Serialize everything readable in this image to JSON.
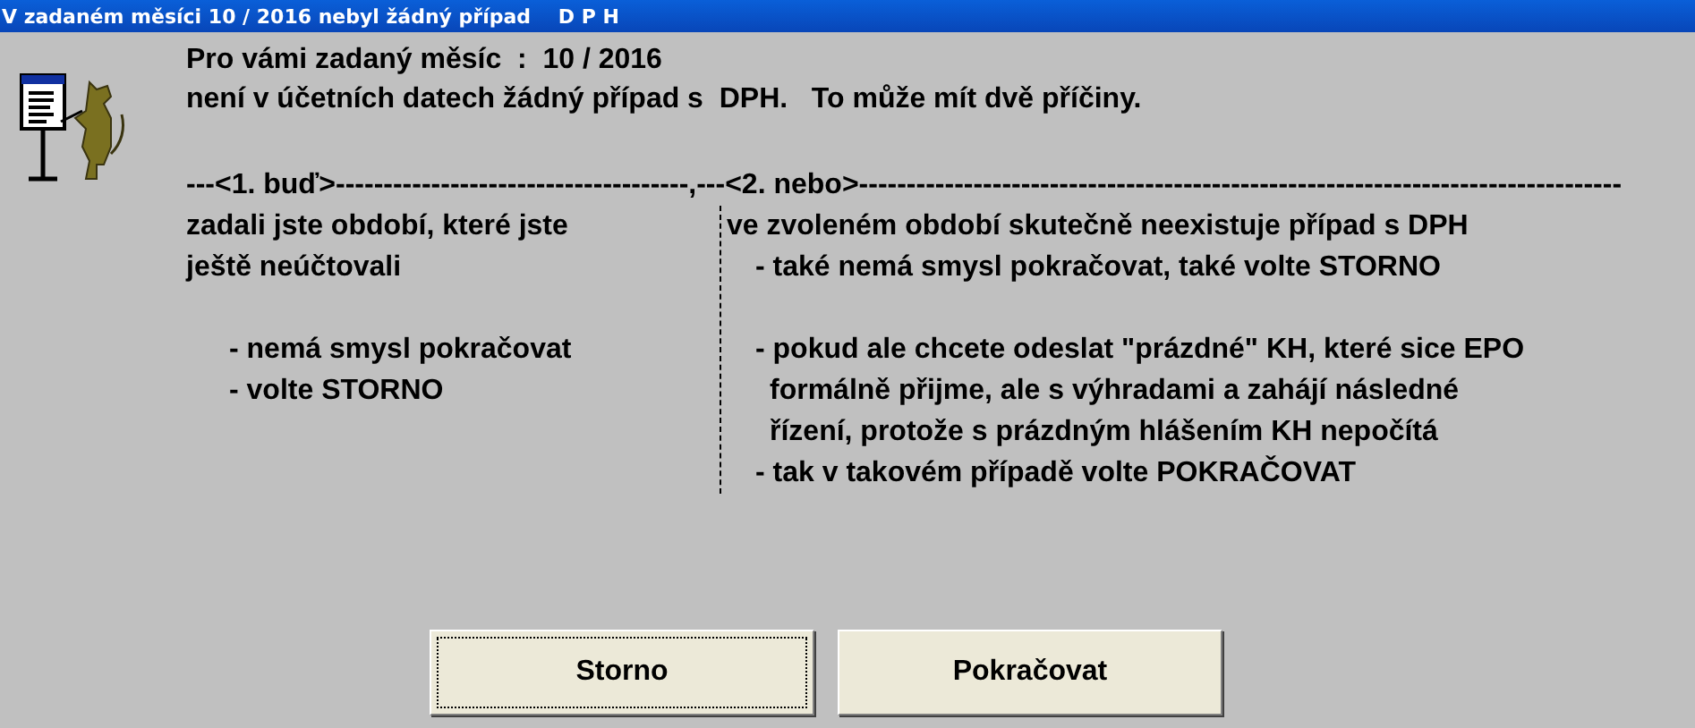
{
  "window": {
    "title": "V zadaném měsíci 10 / 2016 nebyl žádný případ    D P H"
  },
  "intro": [
    "Pro vámi zadaný měsíc  :  10 / 2016",
    "není v účetních datech žádný případ s  DPH.   To může mít dvě příčiny."
  ],
  "heading_left": "---<1. buď>-------------------------------------",
  "heading_right": ",---<2. nebo>--------------------------------------------------------------------------------",
  "left_column": [
    {
      "kind": "text",
      "lines": [
        "zadali jste období, které jste",
        "ještě neúčtovali"
      ]
    },
    {
      "kind": "gap"
    },
    {
      "kind": "bullet",
      "lines": [
        "- nemá smysl pokračovat"
      ]
    },
    {
      "kind": "bullet",
      "lines": [
        "- volte STORNO"
      ]
    }
  ],
  "right_column": [
    {
      "kind": "text",
      "lines": [
        "ve zvoleném období skutečně neexistuje případ s DPH"
      ]
    },
    {
      "kind": "bullet",
      "lines": [
        "- také nemá smysl pokračovat, také volte STORNO"
      ]
    },
    {
      "kind": "gap"
    },
    {
      "kind": "bullet",
      "lines": [
        "- pokud ale chcete odeslat \"prázdné\" KH, které sice EPO",
        "formálně přijme, ale s výhradami a zahájí následné",
        "řízení, protože s prázdným hlášením KH nepočítá"
      ]
    },
    {
      "kind": "bullet",
      "lines": [
        "- tak v takovém případě volte POKRAČOVAT"
      ]
    }
  ],
  "buttons": [
    {
      "label": "Storno",
      "focused": true
    },
    {
      "label": "Pokračovat",
      "focused": false
    }
  ]
}
